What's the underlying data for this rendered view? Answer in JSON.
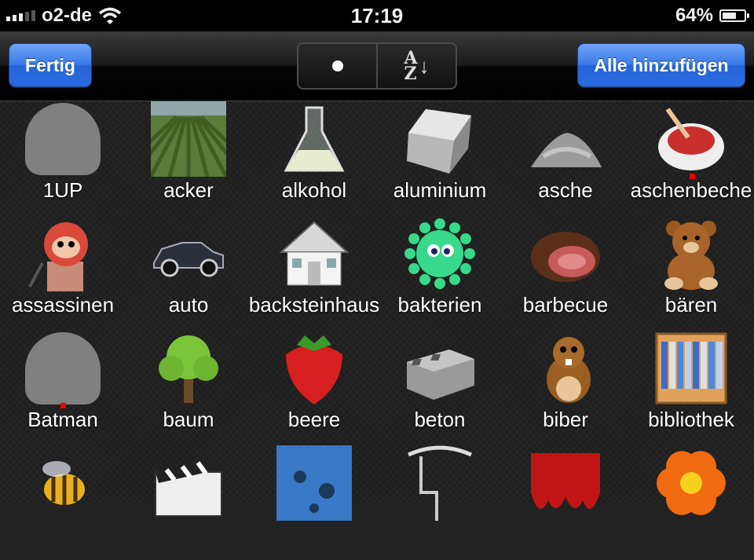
{
  "status_bar": {
    "carrier": "o2-de",
    "time": "17:19",
    "battery_text": "64%",
    "battery_level": 0.64,
    "signal_icon": "signal-bars-icon",
    "wifi_icon": "wifi-icon"
  },
  "toolbar": {
    "done_label": "Fertig",
    "add_all_label": "Alle hinzufügen",
    "sort_az_label_top": "A",
    "sort_az_label_bottom": "Z",
    "sort_az_arrow": "↓"
  },
  "items": [
    {
      "label": "1UP",
      "icon": "placeholder-icon"
    },
    {
      "label": "acker",
      "icon": "field-icon"
    },
    {
      "label": "alkohol",
      "icon": "flask-icon"
    },
    {
      "label": "aluminium",
      "icon": "metal-bar-icon"
    },
    {
      "label": "asche",
      "icon": "ash-pile-icon"
    },
    {
      "label": "aschenbeche",
      "icon": "ashtray-icon"
    },
    {
      "label": "assassinen",
      "icon": "assassin-icon"
    },
    {
      "label": "auto",
      "icon": "car-icon"
    },
    {
      "label": "backsteinhaus",
      "icon": "house-icon"
    },
    {
      "label": "bakterien",
      "icon": "bacteria-icon"
    },
    {
      "label": "barbecue",
      "icon": "meat-icon"
    },
    {
      "label": "bären",
      "icon": "bear-icon"
    },
    {
      "label": "Batman",
      "icon": "placeholder-icon"
    },
    {
      "label": "baum",
      "icon": "tree-icon"
    },
    {
      "label": "beere",
      "icon": "strawberry-icon"
    },
    {
      "label": "beton",
      "icon": "concrete-block-icon"
    },
    {
      "label": "biber",
      "icon": "beaver-icon"
    },
    {
      "label": "bibliothek",
      "icon": "bookshelf-icon"
    },
    {
      "label": "",
      "icon": "bee-icon"
    },
    {
      "label": "",
      "icon": "clapperboard-icon"
    },
    {
      "label": "",
      "icon": "water-icon"
    },
    {
      "label": "",
      "icon": "pipe-icon"
    },
    {
      "label": "",
      "icon": "blood-icon"
    },
    {
      "label": "",
      "icon": "flower-icon"
    }
  ]
}
